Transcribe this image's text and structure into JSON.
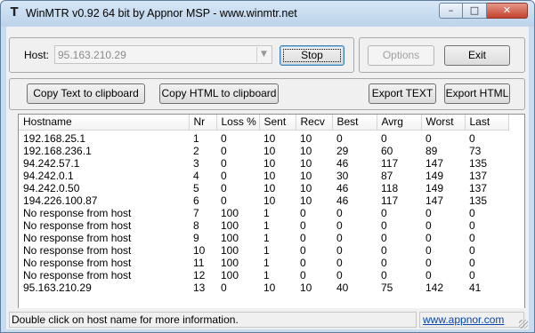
{
  "window": {
    "title": "WinMTR v0.92 64 bit by Appnor MSP - www.winmtr.net",
    "minimize_glyph": "–",
    "maximize_glyph": "□",
    "close_glyph": "✕",
    "app_icon_glyph": "T"
  },
  "host": {
    "label": "Host:",
    "value": "95.163.210.29"
  },
  "buttons": {
    "stop": "Stop",
    "options": "Options",
    "exit": "Exit",
    "copy_text": "Copy Text to clipboard",
    "copy_html": "Copy HTML to clipboard",
    "export_text": "Export TEXT",
    "export_html": "Export HTML"
  },
  "table": {
    "columns": [
      "Hostname",
      "Nr",
      "Loss %",
      "Sent",
      "Recv",
      "Best",
      "Avrg",
      "Worst",
      "Last"
    ],
    "rows": [
      [
        "192.168.25.1",
        "1",
        "0",
        "10",
        "10",
        "0",
        "0",
        "0",
        "0"
      ],
      [
        "192.168.236.1",
        "2",
        "0",
        "10",
        "10",
        "29",
        "60",
        "89",
        "73"
      ],
      [
        "94.242.57.1",
        "3",
        "0",
        "10",
        "10",
        "46",
        "117",
        "147",
        "135"
      ],
      [
        "94.242.0.1",
        "4",
        "0",
        "10",
        "10",
        "30",
        "87",
        "149",
        "137"
      ],
      [
        "94.242.0.50",
        "5",
        "0",
        "10",
        "10",
        "46",
        "118",
        "149",
        "137"
      ],
      [
        "194.226.100.87",
        "6",
        "0",
        "10",
        "10",
        "46",
        "117",
        "147",
        "135"
      ],
      [
        "No response from host",
        "7",
        "100",
        "1",
        "0",
        "0",
        "0",
        "0",
        "0"
      ],
      [
        "No response from host",
        "8",
        "100",
        "1",
        "0",
        "0",
        "0",
        "0",
        "0"
      ],
      [
        "No response from host",
        "9",
        "100",
        "1",
        "0",
        "0",
        "0",
        "0",
        "0"
      ],
      [
        "No response from host",
        "10",
        "100",
        "1",
        "0",
        "0",
        "0",
        "0",
        "0"
      ],
      [
        "No response from host",
        "11",
        "100",
        "1",
        "0",
        "0",
        "0",
        "0",
        "0"
      ],
      [
        "No response from host",
        "12",
        "100",
        "1",
        "0",
        "0",
        "0",
        "0",
        "0"
      ],
      [
        "95.163.210.29",
        "13",
        "0",
        "10",
        "10",
        "40",
        "75",
        "142",
        "41"
      ]
    ]
  },
  "status": {
    "message": "Double click on host name for more information.",
    "link": "www.appnor.com"
  }
}
